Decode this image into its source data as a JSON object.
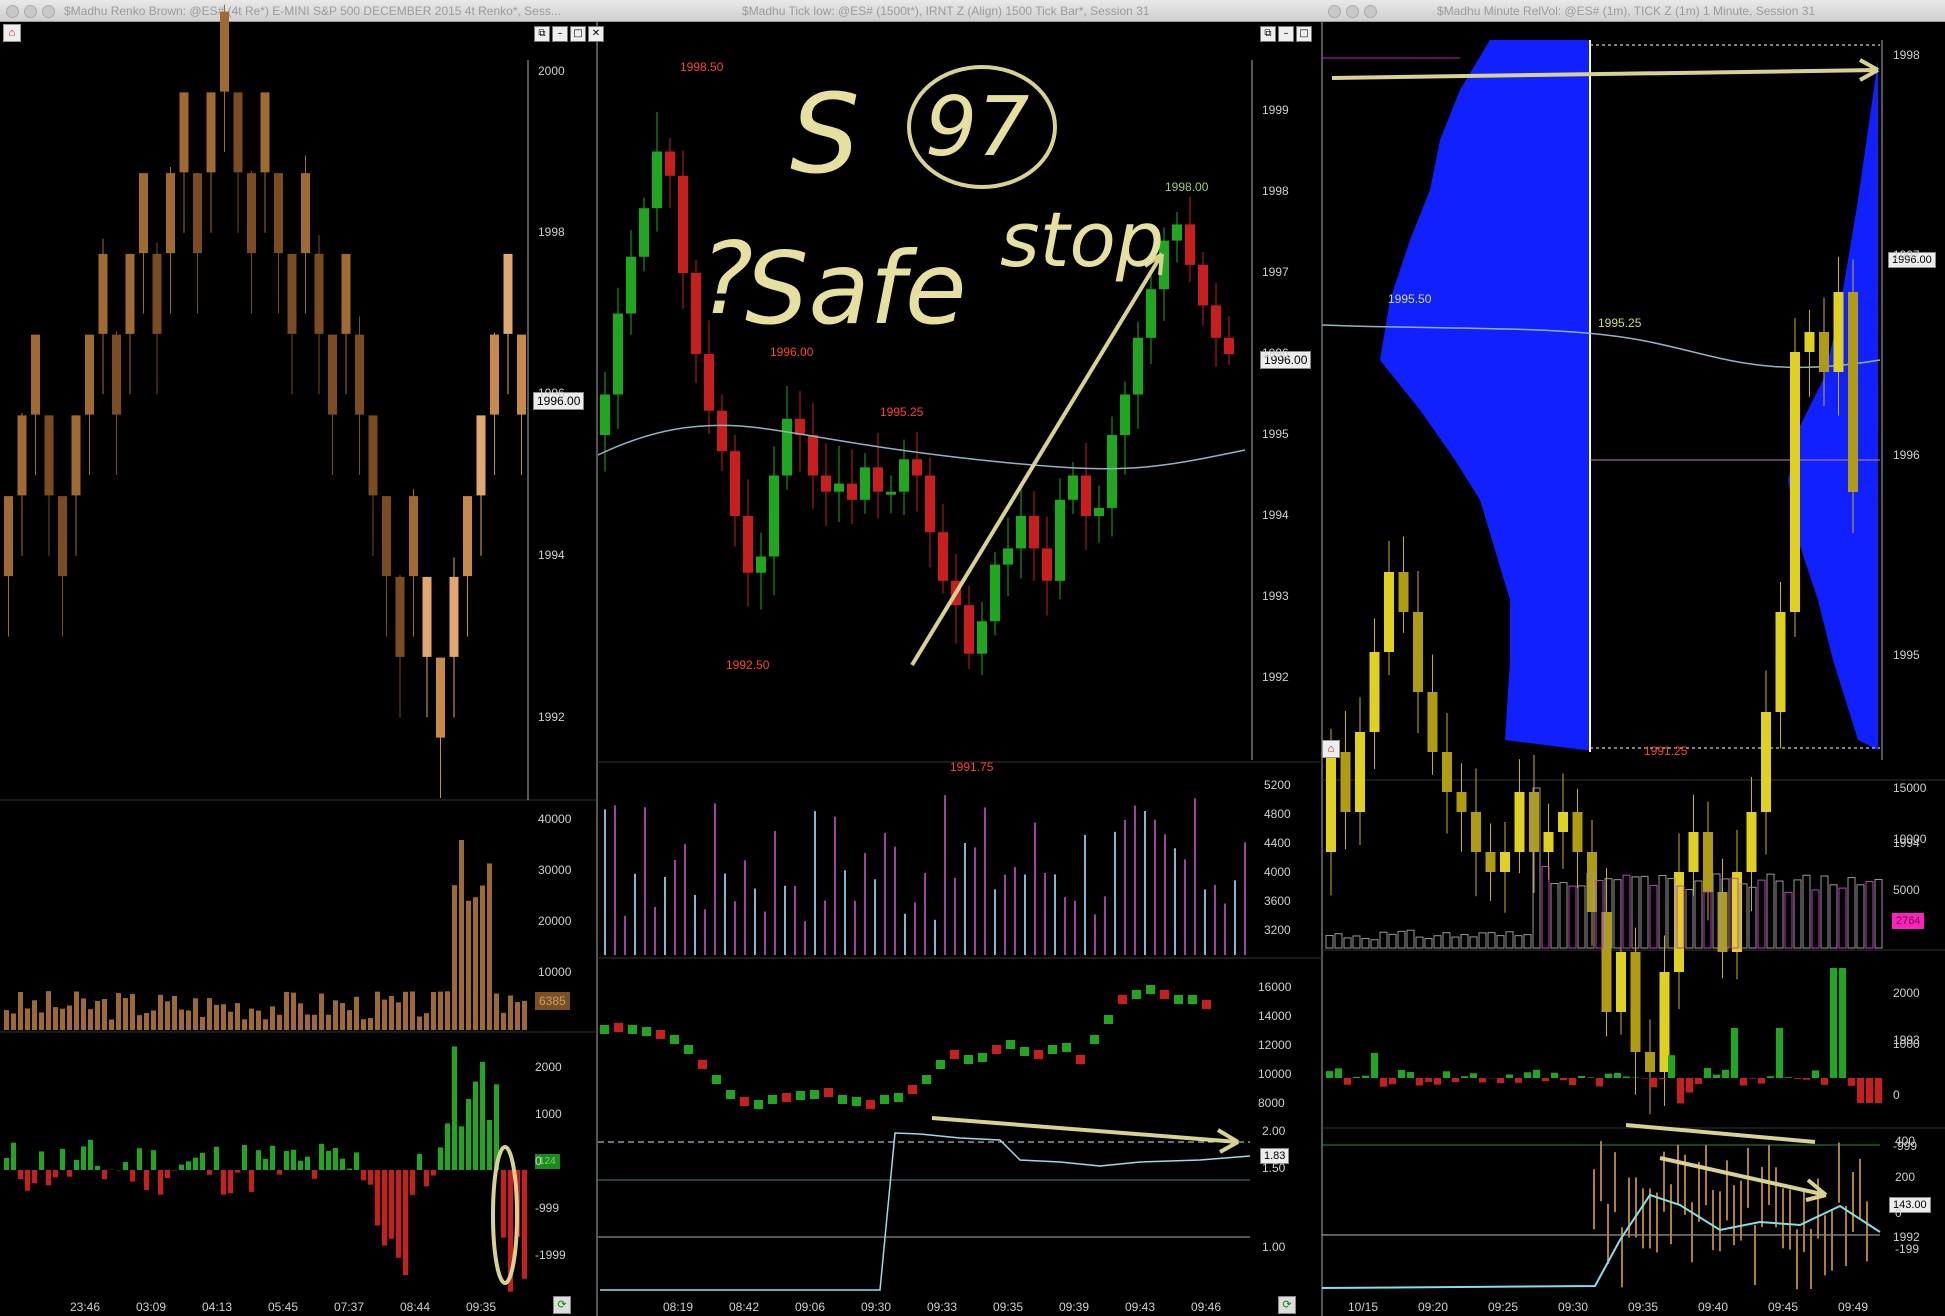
{
  "windows": [
    {
      "title": "$Madhu Renko Brown: @ES# (4t Re*) E-MINI S&P 500 DECEMBER 2015 4t Renko*, Sess..."
    },
    {
      "title": "$Madhu Tick low: @ES# (1500t*), IRNT Z (Align) 1500 Tick Bar*, Session 31"
    },
    {
      "title": "$Madhu Minute RelVol: @ES# (1m), TICK Z (1m) 1 Minute, Session 31"
    }
  ],
  "left": {
    "price_axis": [
      "2000",
      "1998",
      "1996",
      "1994",
      "1992"
    ],
    "last_price": "1996.00",
    "volume_axis": [
      "40000",
      "30000",
      "20000",
      "10000"
    ],
    "volume_last": "6385",
    "osc_axis": [
      "2000",
      "1000",
      "0",
      "-999",
      "-1999"
    ],
    "osc_last": "124",
    "times": [
      "23:46",
      "03:09",
      "04:13",
      "05:45",
      "07:37",
      "08:44",
      "09:35"
    ]
  },
  "middle": {
    "price_axis": [
      "1999",
      "1998",
      "1997",
      "1996",
      "1995",
      "1994",
      "1993",
      "1992"
    ],
    "last_price": "1996.00",
    "annotations": [
      "1998.50",
      "1996.00",
      "1995.25",
      "1992.50",
      "1998.00",
      "1991.75"
    ],
    "volume_axis": [
      "5200",
      "4800",
      "4400",
      "4000",
      "3600",
      "3200"
    ],
    "osc_axis": [
      "16000",
      "14000",
      "12000",
      "10000",
      "8000"
    ],
    "ratio_axis": [
      "2.00",
      "1.50",
      "1.00"
    ],
    "ratio_last": "1.83",
    "times": [
      "08:19",
      "08:42",
      "09:06",
      "09:30",
      "09:33",
      "09:35",
      "09:39",
      "09:43",
      "09:46"
    ]
  },
  "right": {
    "price_axis": [
      "1998",
      "1997",
      "1996",
      "1995",
      "1994",
      "1993",
      "1992"
    ],
    "last_price": "1996.00",
    "annotations": [
      "1995.50",
      "1995.25",
      "1991.25"
    ],
    "volume_axis": [
      "15000",
      "10000",
      "5000"
    ],
    "volume_last": "2764",
    "osc_axis": [
      "2000",
      "1000",
      "0",
      "-999"
    ],
    "tick_axis": [
      "400",
      "200",
      "0",
      "-199"
    ],
    "tick_last": "143.00",
    "times": [
      "10/15",
      "09:20",
      "09:25",
      "09:30",
      "09:35",
      "09:40",
      "09:45",
      "09:49"
    ]
  },
  "handwriting": {
    "s": "S",
    "num": "97",
    "safe": "Safe",
    "stop": "stop",
    "question": "?"
  },
  "colors": {
    "renko_brown": "#b87c3c",
    "up_green": "#1fa81f",
    "down_red": "#c81e1e",
    "gold_candle": "#c8b414",
    "profile_blue": "#1020ff",
    "annot_arrow": "#d8d290"
  }
}
